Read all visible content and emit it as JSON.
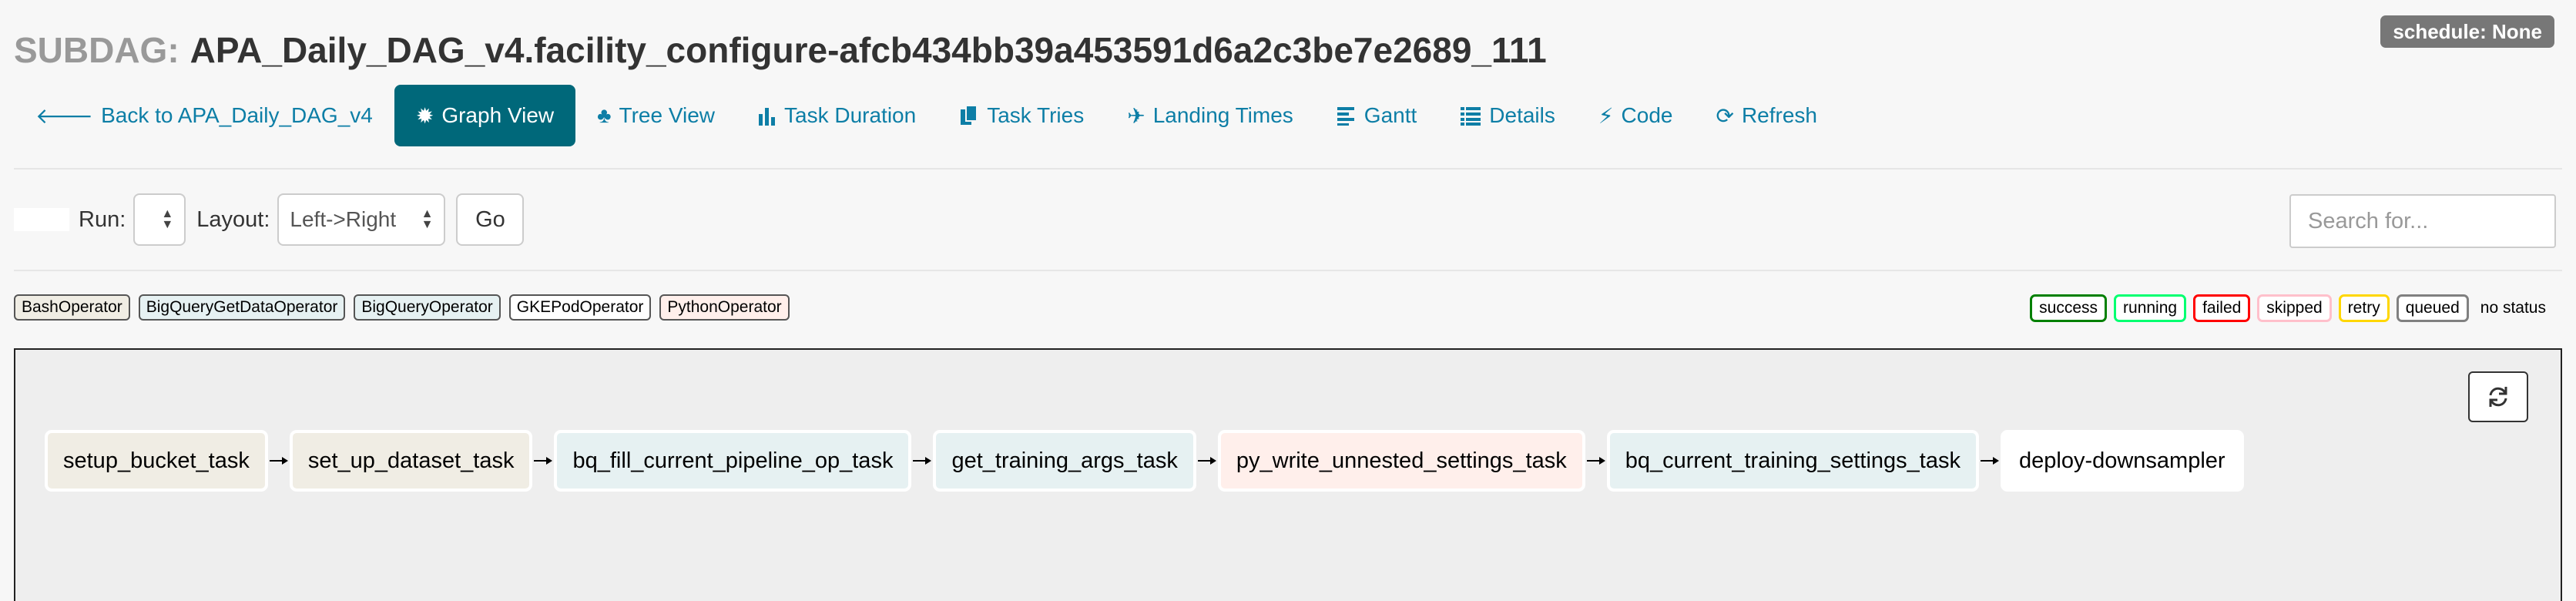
{
  "header": {
    "prefix": "SUBDAG:",
    "title": "APA_Daily_DAG_v4.facility_configure-afcb434bb39a453591d6a2c3be7e2689_111",
    "schedule_badge": "schedule: None"
  },
  "nav": {
    "back": "Back to APA_Daily_DAG_v4",
    "graph_view": "Graph View",
    "tree_view": "Tree View",
    "task_duration": "Task Duration",
    "task_tries": "Task Tries",
    "landing_times": "Landing Times",
    "gantt": "Gantt",
    "details": "Details",
    "code": "Code",
    "refresh": "Refresh"
  },
  "controls": {
    "run_label": "Run:",
    "run_value": "",
    "layout_label": "Layout:",
    "layout_value": "Left->Right",
    "go_label": "Go",
    "search_placeholder": "Search for..."
  },
  "operators": [
    {
      "label": "BashOperator",
      "color": "#f0ede4"
    },
    {
      "label": "BigQueryGetDataOperator",
      "color": "#e6f1f2"
    },
    {
      "label": "BigQueryOperator",
      "color": "#e6f1f2"
    },
    {
      "label": "GKEPodOperator",
      "color": "#ffffff"
    },
    {
      "label": "PythonOperator",
      "color": "#ffefeb"
    }
  ],
  "states": [
    {
      "label": "success",
      "color": "#008000"
    },
    {
      "label": "running",
      "color": "#01ff70"
    },
    {
      "label": "failed",
      "color": "#ff0000"
    },
    {
      "label": "skipped",
      "color": "#ffc0cb"
    },
    {
      "label": "retry",
      "color": "#ffd700"
    },
    {
      "label": "queued",
      "color": "#808080"
    }
  ],
  "no_status_label": "no status",
  "tasks": [
    {
      "label": "setup_bucket_task",
      "color": "#f0ede4"
    },
    {
      "label": "set_up_dataset_task",
      "color": "#f0ede4"
    },
    {
      "label": "bq_fill_current_pipeline_op_task",
      "color": "#e6f1f2"
    },
    {
      "label": "get_training_args_task",
      "color": "#e6f1f2"
    },
    {
      "label": "py_write_unnested_settings_task",
      "color": "#ffefeb"
    },
    {
      "label": "bq_current_training_settings_task",
      "color": "#e6f1f2"
    },
    {
      "label": "deploy-downsampler",
      "color": "#ffffff"
    }
  ],
  "colors": {
    "accent": "#00687a",
    "link": "#0d7ea6"
  }
}
